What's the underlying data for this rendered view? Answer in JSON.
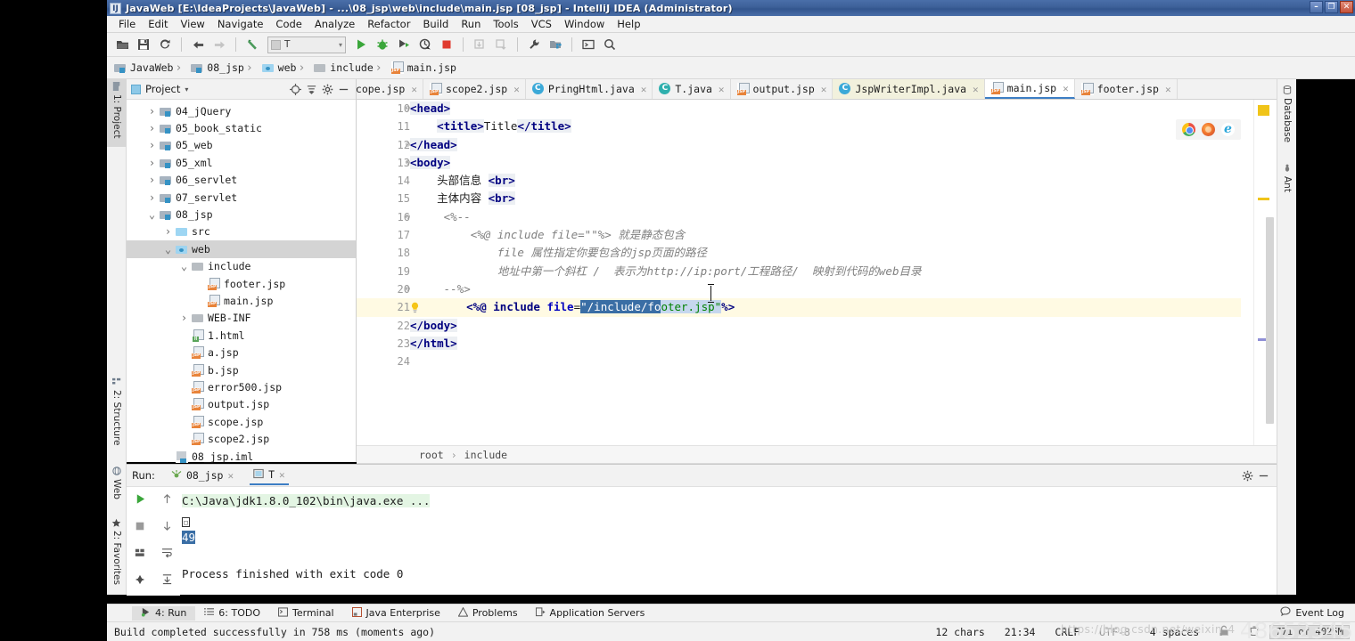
{
  "window": {
    "title": "JavaWeb [E:\\IdeaProjects\\JavaWeb] - ...\\08_jsp\\web\\include\\main.jsp [08_jsp] - IntelliJ IDEA (Administrator)",
    "app_icon": "IJ",
    "minimize": "–",
    "maximize": "❐",
    "close": "✕"
  },
  "menu": {
    "items": [
      "File",
      "Edit",
      "View",
      "Navigate",
      "Code",
      "Analyze",
      "Refactor",
      "Build",
      "Run",
      "Tools",
      "VCS",
      "Window",
      "Help"
    ]
  },
  "toolbar": {
    "buttons": [
      {
        "name": "open-icon",
        "glyph": "📂"
      },
      {
        "name": "save-all-icon",
        "glyph": "💾"
      },
      {
        "name": "sync-icon",
        "glyph": "⟳"
      },
      {
        "name": "back-icon",
        "glyph": "←"
      },
      {
        "name": "forward-icon",
        "glyph": "→"
      },
      {
        "name": "last-edit-location-icon",
        "glyph": "↖"
      }
    ],
    "run_config": {
      "label": "T",
      "arrow": "▾"
    },
    "run_icon": "▶",
    "debug_icon": "🐞",
    "run_coverage_icon": "▶",
    "profile_icon": "◉",
    "stop_icon": "■",
    "update_icon": "⬇",
    "commit_icon": "✔",
    "settings_icon": "🔧",
    "project-structure_icon": "▤",
    "terminal_icon": "▣",
    "search_icon": "🔍"
  },
  "navbar": {
    "crumbs": [
      {
        "label": "JavaWeb",
        "icon": "module-folder-icon"
      },
      {
        "label": "08_jsp",
        "icon": "module-folder-icon"
      },
      {
        "label": "web",
        "icon": "web-folder-icon"
      },
      {
        "label": "include",
        "icon": "folder-icon"
      },
      {
        "label": "main.jsp",
        "icon": "jsp-file-icon"
      }
    ]
  },
  "left_strip": {
    "tabs": [
      {
        "label": "1: Project",
        "selected": true,
        "icon": "project-icon"
      },
      {
        "label": "2: Structure",
        "selected": false,
        "icon": "structure-icon"
      },
      {
        "label": "Web",
        "selected": false,
        "icon": "web-icon"
      },
      {
        "label": "2: Favorites",
        "selected": false,
        "icon": "star-icon"
      }
    ]
  },
  "right_strip": {
    "tabs": [
      {
        "label": "Database",
        "icon": "database-icon"
      },
      {
        "label": "Ant",
        "icon": "ant-icon"
      }
    ]
  },
  "project_panel": {
    "title": "Project",
    "caret": "▾",
    "buttons": [
      {
        "name": "locate-icon",
        "glyph": "⊕"
      },
      {
        "name": "collapse-all-icon",
        "glyph": "≡"
      },
      {
        "name": "settings-gear-icon",
        "glyph": "⚙"
      },
      {
        "name": "hide-icon",
        "glyph": "—"
      }
    ],
    "tree": [
      {
        "label": "04_jQuery",
        "depth": 1,
        "arrow": "›",
        "icon": "module-folder-icon",
        "selected": false
      },
      {
        "label": "05_book_static",
        "depth": 1,
        "arrow": "›",
        "icon": "module-folder-icon",
        "selected": false
      },
      {
        "label": "05_web",
        "depth": 1,
        "arrow": "›",
        "icon": "module-folder-icon",
        "selected": false
      },
      {
        "label": "05_xml",
        "depth": 1,
        "arrow": "›",
        "icon": "module-folder-icon",
        "selected": false
      },
      {
        "label": "06_servlet",
        "depth": 1,
        "arrow": "›",
        "icon": "module-folder-icon",
        "selected": false
      },
      {
        "label": "07_servlet",
        "depth": 1,
        "arrow": "›",
        "icon": "module-folder-icon",
        "selected": false
      },
      {
        "label": "08_jsp",
        "depth": 1,
        "arrow": "⌄",
        "icon": "module-folder-icon",
        "selected": false
      },
      {
        "label": "src",
        "depth": 2,
        "arrow": "›",
        "icon": "source-folder-icon",
        "selected": false
      },
      {
        "label": "web",
        "depth": 2,
        "arrow": "⌄",
        "icon": "web-folder-icon",
        "selected": true
      },
      {
        "label": "include",
        "depth": 3,
        "arrow": "⌄",
        "icon": "folder-icon",
        "selected": false
      },
      {
        "label": "footer.jsp",
        "depth": 4,
        "arrow": "",
        "icon": "jsp-file-icon",
        "selected": false
      },
      {
        "label": "main.jsp",
        "depth": 4,
        "arrow": "",
        "icon": "jsp-file-icon",
        "selected": false
      },
      {
        "label": "WEB-INF",
        "depth": 3,
        "arrow": "›",
        "icon": "folder-icon",
        "selected": false
      },
      {
        "label": "1.html",
        "depth": 3,
        "arrow": "",
        "icon": "html-file-icon",
        "selected": false
      },
      {
        "label": "a.jsp",
        "depth": 3,
        "arrow": "",
        "icon": "jsp-file-icon",
        "selected": false
      },
      {
        "label": "b.jsp",
        "depth": 3,
        "arrow": "",
        "icon": "jsp-file-icon",
        "selected": false
      },
      {
        "label": "error500.jsp",
        "depth": 3,
        "arrow": "",
        "icon": "jsp-file-icon",
        "selected": false
      },
      {
        "label": "output.jsp",
        "depth": 3,
        "arrow": "",
        "icon": "jsp-file-icon",
        "selected": false
      },
      {
        "label": "scope.jsp",
        "depth": 3,
        "arrow": "",
        "icon": "jsp-file-icon",
        "selected": false
      },
      {
        "label": "scope2.jsp",
        "depth": 3,
        "arrow": "",
        "icon": "jsp-file-icon",
        "selected": false
      },
      {
        "label": "08_jsp.iml",
        "depth": 2,
        "arrow": "",
        "icon": "iml-file-icon",
        "selected": false
      }
    ]
  },
  "editor_tabs": [
    {
      "label": "scope.jsp",
      "icon": "jsp-file-icon",
      "state": "normal"
    },
    {
      "label": "scope2.jsp",
      "icon": "jsp-file-icon",
      "state": "normal"
    },
    {
      "label": "PringHtml.java",
      "icon": "java-class-icon",
      "state": "normal"
    },
    {
      "label": "T.java",
      "icon": "java-class-icon-teal",
      "state": "normal"
    },
    {
      "label": "output.jsp",
      "icon": "jsp-file-icon",
      "state": "normal"
    },
    {
      "label": "JspWriterImpl.java",
      "icon": "java-class-icon",
      "state": "tinted"
    },
    {
      "label": "main.jsp",
      "icon": "jsp-file-icon",
      "state": "active"
    },
    {
      "label": "footer.jsp",
      "icon": "jsp-file-icon",
      "state": "normal"
    }
  ],
  "editor": {
    "first_line": 10,
    "lines": [
      {
        "num": 10,
        "fold": "⊖",
        "segments": [
          {
            "t": "<head>",
            "c": "tag tagbg"
          }
        ],
        "indent": 0
      },
      {
        "num": 11,
        "fold": "",
        "segments": [
          {
            "t": "<title>",
            "c": "tag tagbg"
          },
          {
            "t": "Title",
            "c": "txt"
          },
          {
            "t": "</title>",
            "c": "tag tagbg"
          }
        ],
        "indent": 4
      },
      {
        "num": 12,
        "fold": "⊖",
        "segments": [
          {
            "t": "</head>",
            "c": "tag tagbg"
          }
        ],
        "indent": 0
      },
      {
        "num": 13,
        "fold": "⊖",
        "segments": [
          {
            "t": "<body>",
            "c": "tag tagbg"
          }
        ],
        "indent": 0
      },
      {
        "num": 14,
        "fold": "",
        "segments": [
          {
            "t": "头部信息 ",
            "c": "txt"
          },
          {
            "t": "<br>",
            "c": "tag tagbg"
          }
        ],
        "indent": 4
      },
      {
        "num": 15,
        "fold": "",
        "segments": [
          {
            "t": "主体内容 ",
            "c": "txt"
          },
          {
            "t": "<br>",
            "c": "tag tagbg"
          }
        ],
        "indent": 4
      },
      {
        "num": 16,
        "fold": "⊖",
        "segments": [
          {
            "t": "<%--",
            "c": "cmt"
          }
        ],
        "indent": 5
      },
      {
        "num": 17,
        "fold": "",
        "segments": [
          {
            "t": "<%@ include file=\"\"%> 就是静态包含",
            "c": "cmt"
          }
        ],
        "indent": 9
      },
      {
        "num": 18,
        "fold": "",
        "segments": [
          {
            "t": "file 属性指定你要包含的jsp页面的路径",
            "c": "cmt"
          }
        ],
        "indent": 13
      },
      {
        "num": 19,
        "fold": "",
        "segments": [
          {
            "t": "地址中第一个斜杠 /  表示为http://ip:port/工程路径/  映射到代码的web目录",
            "c": "cmt"
          }
        ],
        "indent": 13
      },
      {
        "num": 20,
        "fold": "⊖",
        "segments": [
          {
            "t": "--%>",
            "c": "cmt"
          }
        ],
        "indent": 5
      },
      {
        "num": 21,
        "fold": "",
        "highlight": true,
        "bulb": true,
        "segments": [
          {
            "t": "<%@ ",
            "c": "scriptlet"
          },
          {
            "t": "include",
            "c": "scriptlet"
          },
          {
            "t": " ",
            "c": "txt"
          },
          {
            "t": "file",
            "c": "attr"
          },
          {
            "t": "=",
            "c": "txt"
          },
          {
            "t": "\"/include/fo",
            "c": "sel-blue"
          },
          {
            "t": "oter.jsp\"",
            "c": "sel-lite strv"
          },
          {
            "t": "%>",
            "c": "scriptlet"
          }
        ],
        "indent": 6
      },
      {
        "num": 22,
        "fold": "",
        "segments": [
          {
            "t": "</body>",
            "c": "tag tagbg"
          }
        ],
        "indent": 0
      },
      {
        "num": 23,
        "fold": "",
        "segments": [
          {
            "t": "</html>",
            "c": "tag tagbg"
          }
        ],
        "indent": 0
      },
      {
        "num": 24,
        "fold": "",
        "segments": [],
        "indent": 0
      }
    ],
    "breadcrumb": [
      "root",
      "include"
    ],
    "breadcrumb_sep": "›",
    "browsers": [
      {
        "name": "chrome-icon",
        "label": "Chrome"
      },
      {
        "name": "firefox-icon",
        "label": "Firefox"
      },
      {
        "name": "ie-icon",
        "label": "e"
      }
    ]
  },
  "run_window": {
    "label": "Run:",
    "tabs": [
      {
        "label": "08_jsp",
        "icon": "run-config-icon",
        "active": false,
        "close": "✕"
      },
      {
        "label": "T",
        "icon": "console-icon",
        "active": true,
        "close": "✕"
      }
    ],
    "toolbar_left": [
      {
        "name": "rerun-icon",
        "glyph": "▶"
      },
      {
        "name": "stop-icon",
        "glyph": "■"
      },
      {
        "name": "layout-icon",
        "glyph": "▤"
      },
      {
        "name": "pin-icon",
        "glyph": "📌"
      }
    ],
    "toolbar_right": [
      {
        "name": "up-arrow-icon",
        "glyph": "↑"
      },
      {
        "name": "down-arrow-icon",
        "glyph": "↓"
      },
      {
        "name": "soft-wrap-icon",
        "glyph": "↵"
      },
      {
        "name": "scroll-to-end-icon",
        "glyph": "↧"
      }
    ],
    "settings_icon": "⚙",
    "hide_icon": "—",
    "output": [
      {
        "text": "C:\\Java\\jdk1.8.0_102\\bin\\java.exe ...",
        "style": "cmd"
      },
      {
        "text": "□",
        "style": "box"
      },
      {
        "text": "49",
        "style": "selected"
      },
      {
        "text": "",
        "style": "plain"
      },
      {
        "text": "Process finished with exit code 0",
        "style": "plain"
      }
    ]
  },
  "bottom_tabs": {
    "items": [
      {
        "label": "4: Run",
        "icon": "run-icon",
        "active": true
      },
      {
        "label": "6: TODO",
        "icon": "todo-icon",
        "active": false
      },
      {
        "label": "Terminal",
        "icon": "terminal-icon",
        "active": false
      },
      {
        "label": "Java Enterprise",
        "icon": "java-enterprise-icon",
        "active": false
      },
      {
        "label": "Problems",
        "icon": "warning-icon",
        "active": false
      },
      {
        "label": "Application Servers",
        "icon": "app-servers-icon",
        "active": false
      }
    ],
    "event_log": {
      "label": "Event Log",
      "icon": "event-log-icon"
    }
  },
  "status_bar": {
    "message": "Build completed successfully in 758 ms (moments ago)",
    "chars": "12 chars",
    "caret": "21:34",
    "line_sep": "CRLF",
    "encoding": "UTF-8",
    "indent": "4 spaces",
    "lock_icon": "🔓",
    "trash_icon": "🗑",
    "memory": "771 of 4025M"
  },
  "watermark": {
    "text": "https://blog.csdn.net/weixin_4",
    "number": "48652345"
  }
}
